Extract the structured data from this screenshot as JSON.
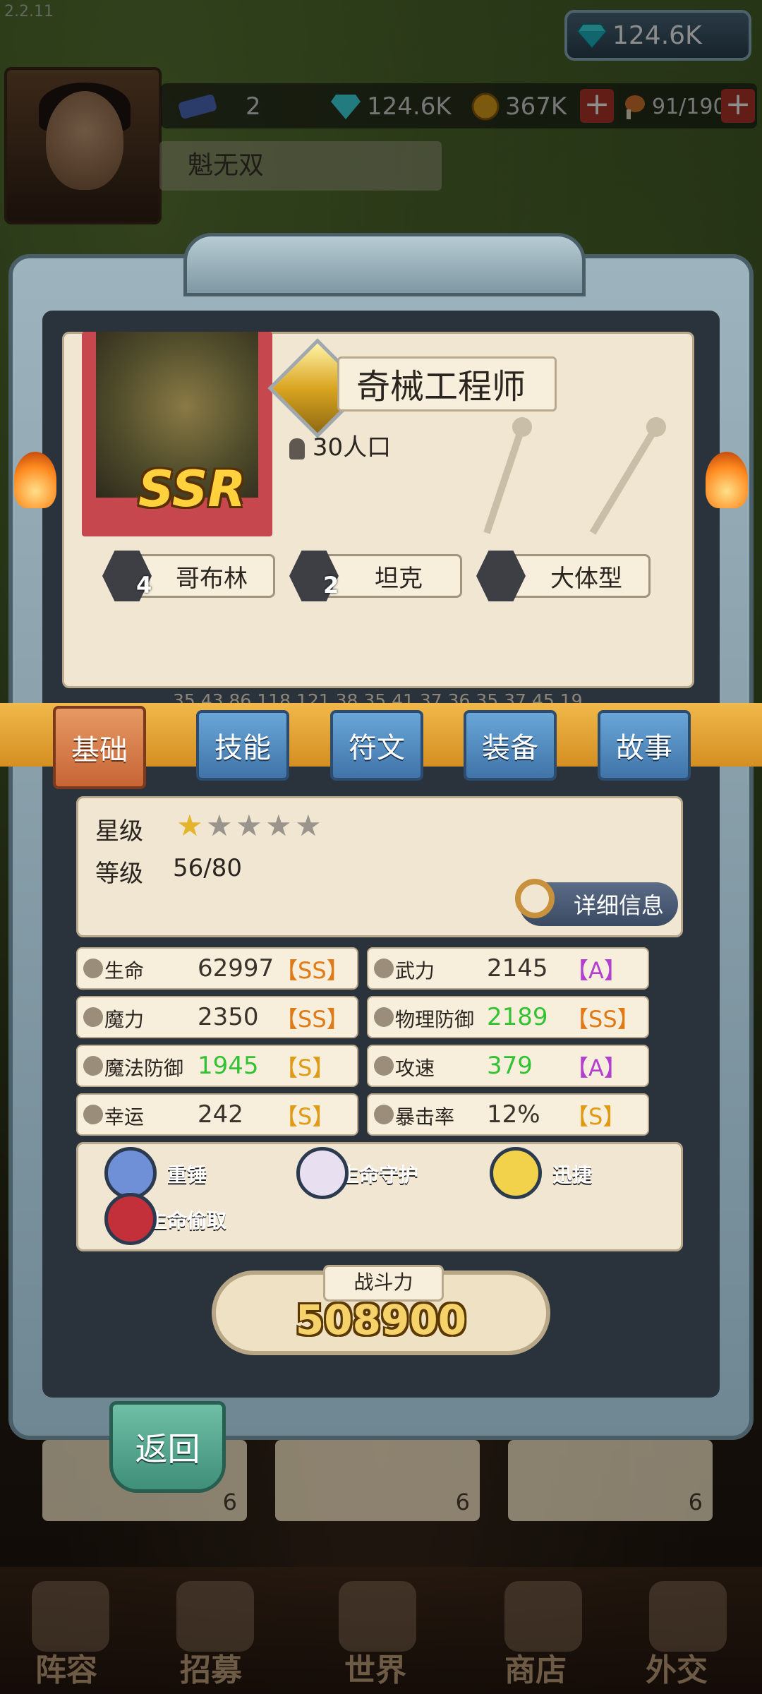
{
  "version": "2.2.11",
  "top_currency": {
    "gem": "124.6K",
    "icon": "diamond-icon"
  },
  "resources": {
    "ticket": "2",
    "gems": "124.6K",
    "gold": "367K",
    "food": "91/190"
  },
  "player_name": "魁无双",
  "hero": {
    "rarity": "SSR",
    "name": "奇械工程师",
    "population": "30人口",
    "tags": [
      {
        "label": "哥布林",
        "num": "4"
      },
      {
        "label": "坦克",
        "num": "2"
      },
      {
        "label": "大体型",
        "num": ""
      }
    ],
    "debug_strip": "35,43,86,118,121,38,35,41,37,36,35,37,45,19"
  },
  "tabs": [
    "基础",
    "技能",
    "符文",
    "装备",
    "故事"
  ],
  "basic": {
    "star_label": "星级",
    "stars_filled": 1,
    "stars_total": 5,
    "level_label": "等级",
    "level": "56/80",
    "detail_button": "详细信息"
  },
  "stats": [
    {
      "name": "生命",
      "value": "62997",
      "grade": "【SS】",
      "value_color": "#3a332b",
      "grade_color": "#e07a16"
    },
    {
      "name": "武力",
      "value": "2145",
      "grade": "【A】",
      "value_color": "#3a332b",
      "grade_color": "#b23fd0"
    },
    {
      "name": "魔力",
      "value": "2350",
      "grade": "【SS】",
      "value_color": "#3a332b",
      "grade_color": "#e07a16"
    },
    {
      "name": "物理防御",
      "value": "2189",
      "grade": "【SS】",
      "value_color": "#33c233",
      "grade_color": "#e07a16"
    },
    {
      "name": "魔法防御",
      "value": "1945",
      "grade": "【S】",
      "value_color": "#33c233",
      "grade_color": "#e09a16"
    },
    {
      "name": "攻速",
      "value": "379",
      "grade": "【A】",
      "value_color": "#33c233",
      "grade_color": "#b23fd0"
    },
    {
      "name": "幸运",
      "value": "242",
      "grade": "【S】",
      "value_color": "#3a332b",
      "grade_color": "#e09a16"
    },
    {
      "name": "暴击率",
      "value": "12%",
      "grade": "【S】",
      "value_color": "#3a332b",
      "grade_color": "#e09a16"
    }
  ],
  "skills": [
    {
      "label": "重锤",
      "color": "#4a86d8"
    },
    {
      "label": "生命守护",
      "color": "#3f76c7"
    },
    {
      "label": "迅捷",
      "color": "#d9b41d"
    },
    {
      "label": "生命偷取",
      "color": "#a63fc5"
    }
  ],
  "power": {
    "label": "战斗力",
    "value": "508900"
  },
  "back_button": "返回",
  "behind_cards": [
    {
      "count": "6"
    },
    {
      "count": "6"
    },
    {
      "count": "6"
    }
  ],
  "nav": [
    "阵容",
    "招募",
    "世界",
    "商店",
    "外交"
  ]
}
